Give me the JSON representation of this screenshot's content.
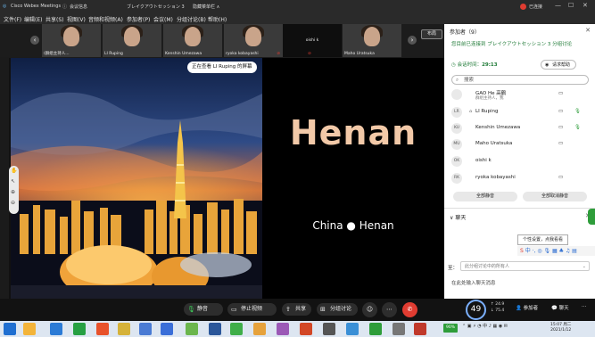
{
  "titlebar": {
    "app_name": "Cisco Webex Meetings",
    "meeting_info": "会议信息",
    "session_name": "ブレイクアウトセッション 3",
    "hide_menu": "隐藏菜单栏 ∧",
    "recording_label": "已连接"
  },
  "menu": [
    "文件(F)",
    "编辑(E)",
    "共享(S)",
    "视图(V)",
    "音频和视频(A)",
    "参加者(P)",
    "会议(M)",
    "分组讨论(B)",
    "帮助(H)"
  ],
  "strip": {
    "thumbs": [
      {
        "name": "(群组主持人...",
        "muted": true,
        "dark": false
      },
      {
        "name": "LI Ruping",
        "muted": false,
        "dark": false
      },
      {
        "name": "Kenshin Umezawa",
        "muted": false,
        "dark": false
      },
      {
        "name": "ryoka kobayashi",
        "muted": true,
        "dark": false
      },
      {
        "name": "oishi k",
        "muted": true,
        "dark": true
      },
      {
        "name": "Maho Uratsuka",
        "muted": true,
        "dark": false
      }
    ],
    "layout_button": "布局"
  },
  "share": {
    "viewing_label": "正在查看 LI Ruping 的屏幕",
    "slide_title": "Henan",
    "slide_subtitle": "China ● Henan"
  },
  "toolbar": {
    "mute": "静音",
    "stop_video": "停止视频",
    "share": "共享",
    "breakout": "分组讨论"
  },
  "panel": {
    "participants_header": "参加者（9）",
    "connected_info": "您目前已连接到 ブレイクアウトセッション 3 分组讨论",
    "session_time_label": "会话时间：",
    "session_time": "29:13",
    "ask_help": "请求帮助",
    "search_placeholder": "搜索",
    "participants": [
      {
        "initials": "",
        "name": "GAO He 高鶴",
        "sub": "群组主持人，我",
        "mic_on": false
      },
      {
        "initials": "LR",
        "name": "LI Ruping",
        "sub": "",
        "mic_on": true
      },
      {
        "initials": "KU",
        "name": "Kenshin Umezawa",
        "sub": "",
        "mic_on": false
      },
      {
        "initials": "MU",
        "name": "Maho Uratsuka",
        "sub": "",
        "mic_on": false
      },
      {
        "initials": "OK",
        "name": "oishi k",
        "sub": "",
        "mic_on": false
      },
      {
        "initials": "RK",
        "name": "ryoka kobayashi",
        "sub": "",
        "mic_on": false
      }
    ],
    "mute_all": "全部静音",
    "unmute_all": "全部取消静音",
    "chat_header": "聊天",
    "chat_tip": "个性设置，点我看看",
    "to_label": "至：",
    "to_select": "此分组讨论中的所有人",
    "chat_input_placeholder": "在此处输入聊天消息"
  },
  "bottom_right": {
    "network_value": "49",
    "upload": "24.9",
    "download": "75.4",
    "participants_btn": "参加者",
    "chat_btn": "聊天"
  },
  "taskbar": {
    "clock_time": "15:07 周二",
    "clock_date": "2021/1/12",
    "battery_badge": "90%"
  },
  "colors": {
    "webex_green": "#1e7a36",
    "end_red": "#e03c31",
    "slide_title": "#f2c9a8"
  }
}
